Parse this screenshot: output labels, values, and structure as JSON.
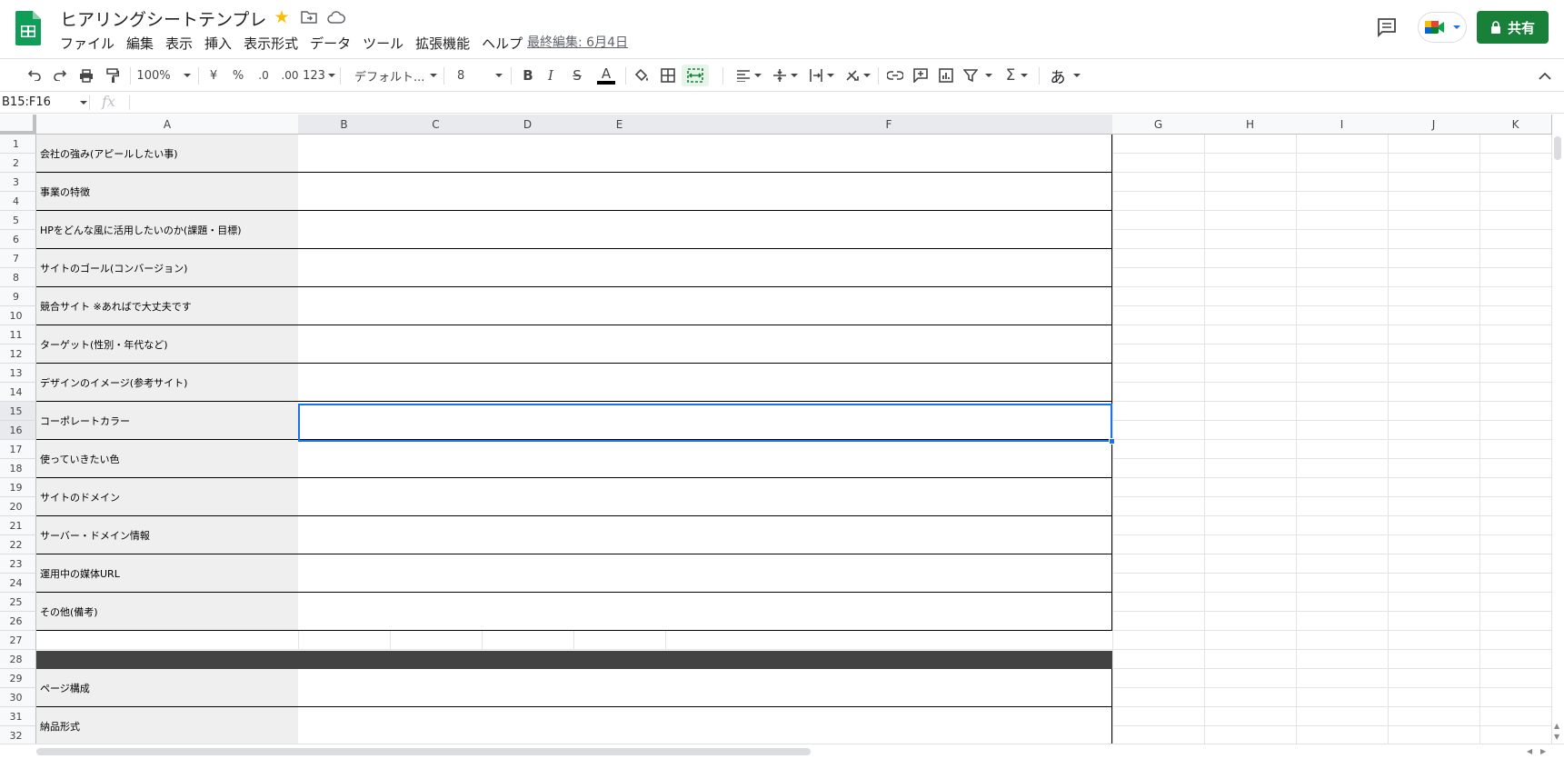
{
  "header": {
    "title": "ヒアリングシートテンプレ",
    "menu": [
      "ファイル",
      "編集",
      "表示",
      "挿入",
      "表示形式",
      "データ",
      "ツール",
      "拡張機能",
      "ヘルプ"
    ],
    "last_edit": "最終編集: 6月4日",
    "share_label": "共有",
    "icons": [
      "sheets-logo-icon",
      "star-icon",
      "move-folder-icon",
      "cloud-status-icon",
      "comments-icon",
      "meet-icon",
      "lock-icon"
    ],
    "star_color": "#fbbc04",
    "share_color": "#188038"
  },
  "toolbar": {
    "zoom": "100%",
    "currency": "¥",
    "percent": "%",
    "decrease_decimal": ".0",
    "increase_decimal": ".00",
    "more_formats": "123",
    "font": "デフォルト...",
    "font_size": "8",
    "bold": "B",
    "italic": "I",
    "strike": "S",
    "text_color": "A",
    "input_tools": "あ"
  },
  "formula_bar": {
    "name_box": "B15:F16",
    "fx": "fx",
    "value": ""
  },
  "grid": {
    "columns": [
      "A",
      "B",
      "C",
      "D",
      "E",
      "F",
      "G",
      "H",
      "I",
      "J",
      "K"
    ],
    "selected_columns": [
      "B",
      "C",
      "D",
      "E",
      "F"
    ],
    "rows": [
      "1",
      "2",
      "3",
      "4",
      "5",
      "6",
      "7",
      "8",
      "9",
      "10",
      "11",
      "12",
      "13",
      "14",
      "15",
      "16",
      "17",
      "18",
      "19",
      "20",
      "21",
      "22",
      "23",
      "24",
      "25",
      "26",
      "27",
      "28",
      "29",
      "30",
      "31",
      "32"
    ],
    "selected_rows": [
      "15",
      "16"
    ],
    "labels": [
      "会社の強み(アピールしたい事)",
      "事業の特徴",
      "HPをどんな風に活用したいのか(課題・目標)",
      "サイトのゴール(コンバージョン)",
      "競合サイト ※あればで大丈夫です",
      "ターゲット(性別・年代など)",
      "デザインのイメージ(参考サイト)",
      "コーポレートカラー",
      "使っていきたい色",
      "サイトのドメイン",
      "サーバー・ドメイン情報",
      "運用中の媒体URL",
      "その他(備考)"
    ],
    "labels_section2": [
      "ページ構成",
      "納品形式"
    ],
    "section_bar_color": "#434343",
    "selection_color": "#1a73e8"
  }
}
